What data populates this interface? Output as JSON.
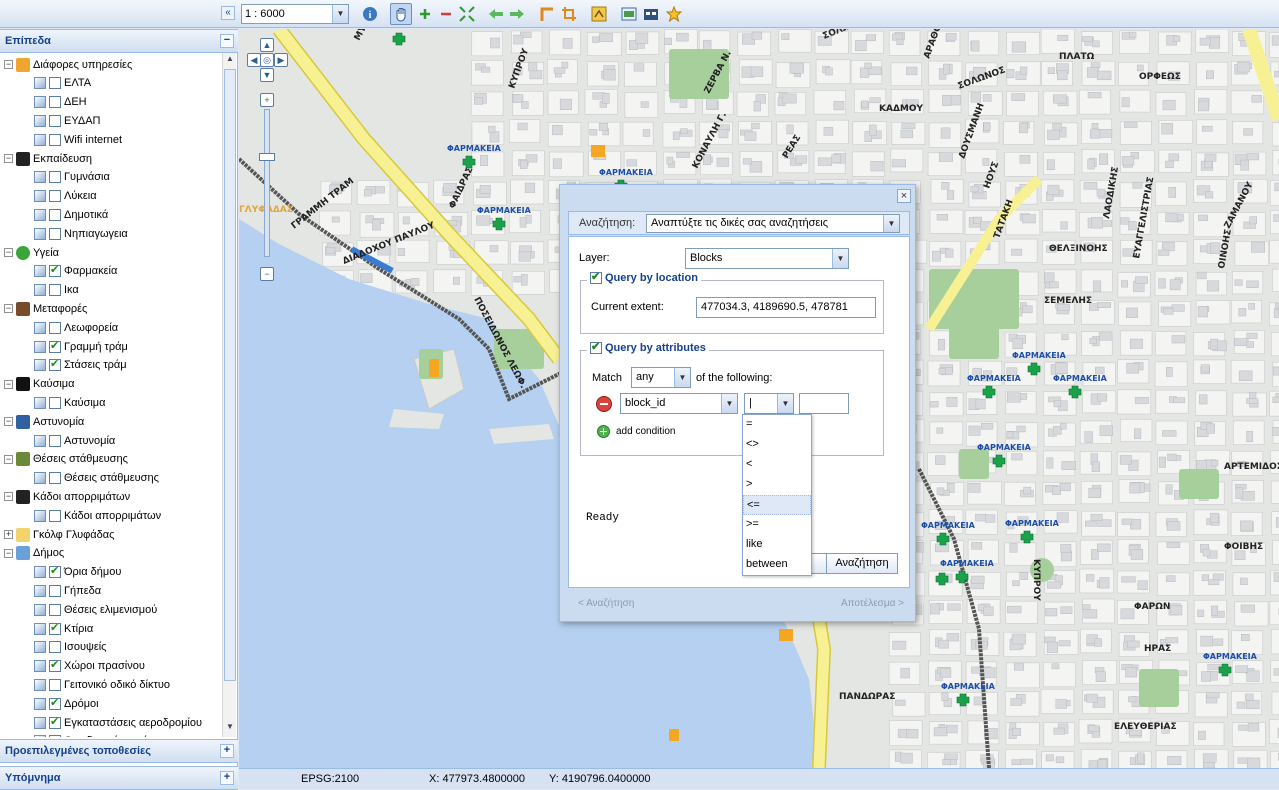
{
  "toolbar": {
    "scale": "1 : 6000",
    "icons": [
      "collapse-left-icon",
      "info-icon",
      "pan-hand-icon",
      "zoom-in-icon",
      "zoom-out-icon",
      "zoom-extent-icon",
      "back-arrow-icon",
      "forward-arrow-icon",
      "measure-length-icon",
      "measure-area-icon",
      "print-icon",
      "export-icon",
      "layers-icon",
      "bookmark-star-icon"
    ]
  },
  "left": {
    "layers_title": "Επίπεδα",
    "presets_title": "Προεπιλεγμένες τοποθεσίες",
    "legend_title": "Υπόμνημα",
    "tree": [
      {
        "type": "group",
        "label": "Διάφορες υπηρεσίες",
        "icon": "services-icon",
        "expanded": true
      },
      {
        "type": "leaf",
        "label": "ΕΛΤΑ",
        "checked": false
      },
      {
        "type": "leaf",
        "label": "ΔΕΗ",
        "checked": false
      },
      {
        "type": "leaf",
        "label": "ΕΥΔΑΠ",
        "checked": false
      },
      {
        "type": "leaf",
        "label": "Wifi internet",
        "checked": false
      },
      {
        "type": "group",
        "label": "Εκπαίδευση",
        "icon": "education-icon",
        "expanded": true
      },
      {
        "type": "leaf",
        "label": "Γυμνάσια",
        "checked": false
      },
      {
        "type": "leaf",
        "label": "Λύκεια",
        "checked": false
      },
      {
        "type": "leaf",
        "label": "Δημοτικά",
        "checked": false
      },
      {
        "type": "leaf",
        "label": "Νηπιαγωγεια",
        "checked": false
      },
      {
        "type": "group",
        "label": "Υγεία",
        "icon": "health-icon",
        "expanded": true
      },
      {
        "type": "leaf",
        "label": "Φαρμακεία",
        "checked": true
      },
      {
        "type": "leaf",
        "label": "Ικα",
        "checked": false
      },
      {
        "type": "group",
        "label": "Μεταφορές",
        "icon": "transport-icon",
        "expanded": true
      },
      {
        "type": "leaf",
        "label": "Λεωφορεία",
        "checked": false
      },
      {
        "type": "leaf",
        "label": "Γραμμή τράμ",
        "checked": true
      },
      {
        "type": "leaf",
        "label": "Στάσεις τράμ",
        "checked": true
      },
      {
        "type": "group",
        "label": "Καύσιμα",
        "icon": "fuel-icon",
        "expanded": true
      },
      {
        "type": "leaf",
        "label": "Καύσιμα",
        "checked": false
      },
      {
        "type": "group",
        "label": "Αστυνομία",
        "icon": "police-icon",
        "expanded": true
      },
      {
        "type": "leaf",
        "label": "Αστυνομία",
        "checked": false
      },
      {
        "type": "group",
        "label": "Θέσεις στάθμευσης",
        "icon": "parking-icon",
        "expanded": true
      },
      {
        "type": "leaf",
        "label": "Θέσεις στάθμευσης",
        "checked": false
      },
      {
        "type": "group",
        "label": "Κάδοι απορριμάτων",
        "icon": "bins-icon",
        "expanded": true
      },
      {
        "type": "leaf",
        "label": "Κάδοι απορριμάτων",
        "checked": false
      },
      {
        "type": "group",
        "label": "Γκόλφ Γλυφάδας",
        "icon": "folder-icon",
        "expanded": false
      },
      {
        "type": "group",
        "label": "Δήμος",
        "icon": "municipality-icon",
        "expanded": true
      },
      {
        "type": "leaf",
        "label": "Όρια δήμου",
        "checked": true
      },
      {
        "type": "leaf",
        "label": "Γήπεδα",
        "checked": false
      },
      {
        "type": "leaf",
        "label": "Θέσεις ελιμενισμού",
        "checked": false
      },
      {
        "type": "leaf",
        "label": "Κτίρια",
        "checked": true
      },
      {
        "type": "leaf",
        "label": "Ισουψείς",
        "checked": false
      },
      {
        "type": "leaf",
        "label": "Χώροι πρασίνου",
        "checked": true
      },
      {
        "type": "leaf",
        "label": "Γειτονικό οδικό δίκτυο",
        "checked": false
      },
      {
        "type": "leaf",
        "label": "Δρόμοι",
        "checked": true
      },
      {
        "type": "leaf",
        "label": "Εγκαταστάσεις αεροδρομίου",
        "checked": true
      },
      {
        "type": "leaf",
        "label": "Οικοδομικά τετράγωνα",
        "checked": false
      }
    ]
  },
  "map": {
    "streets": [
      "ΜΥΡΤΟΥΣ",
      "ΚΥΠΡΟΥ",
      "ΖΕΡΒΑ Ν.",
      "ΣΟΛΩΝΟΣ",
      "ΑΡΑΘΟΥ",
      "ΣΟΛΩΝΟΣ",
      "ΚΑΔΜΟΥ",
      "ΚΟΝΑΥΛΗ Γ.",
      "ΡΕΑΣ",
      "ΔΟΥΣΜΑΝΗ",
      "ΗΟΥΣ",
      "ΤΑΤΑΚΗ",
      "ΦΑΙΔΡΑΣ",
      "ΔΙΑΔΟΧΟΥ ΠΑΥΛΟΥ",
      "ΠΟΣΕΙΔΩΝΟΣ ΛΕΩΦ.",
      "ΓΡΑΜΜΗ ΤΡΑΜ",
      "ΟΡΦΕΩΣ",
      "ΠΛΑΤΩ",
      "ΘΕΛΞΙΝΟΗΣ",
      "ΣΕΜΕΛΗΣ",
      "ΛΑΟΔΙΚΗΣ",
      "ΕΥΑΓΓΕΛΙΣΤΡΙΑΣ",
      "ΟΙΝΟΗΣ",
      "ΖΑΜΑΝΟΥ",
      "ΑΡΤΕΜΙΔΟΣ",
      "ΦΟΙΒΗΣ",
      "ΦΑΡΩΝ",
      "ΗΡΑΣ",
      "ΠΑΝΔΩΡΑΣ",
      "ΕΛΕΥΘΕΡΙΑΣ",
      "ΚΥΠΡΟΥ",
      "ΓΛΥΦΑΔΑΣ"
    ],
    "pharmacy_label": "ΦΑΡΜΑΚΕΙΑ",
    "colors": {
      "water": "#b5d0f0",
      "land": "#e4e6e3",
      "block": "#f4f4f2",
      "building": "#d7d9dc",
      "park": "#a7cf9c",
      "motorway": "#f7f193",
      "tram": "#555555"
    }
  },
  "status": {
    "epsg": "EPSG:2100",
    "x": "X: 477973.4800000",
    "y": "Y: 4190796.0400000"
  },
  "dialog": {
    "search_label": "Αναζήτηση:",
    "search_value": "Αναπτύξτε τις δικές σας αναζητήσεις",
    "layer_label": "Layer:",
    "layer_value": "Blocks",
    "location_legend": "Query by location",
    "location_checked": true,
    "extent_label": "Current extent:",
    "extent_value": "477034.3, 4189690.5, 478781",
    "attributes_legend": "Query by attributes",
    "attributes_checked": true,
    "match_label": "Match",
    "match_value": "any",
    "match_suffix": "of the following:",
    "field_value": "block_id",
    "operator_value": "|",
    "value_input": "",
    "add_condition": "add condition",
    "status": "Ready",
    "cancel_label": "",
    "search_button": "Αναζήτηση",
    "footer_prev": "< Αναζήτηση",
    "footer_next": "Αποτέλεσμα >",
    "close_label": "×"
  },
  "operators": [
    "=",
    "<>",
    "<",
    ">",
    "<=",
    ">=",
    "like",
    "between"
  ],
  "selected_operator_index": 4
}
